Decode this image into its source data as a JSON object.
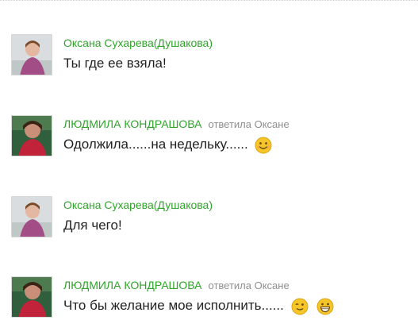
{
  "messages": [
    {
      "author": "Оксана Сухарева(Душакова)",
      "reply_note": "",
      "text": "Ты где ее взяла!",
      "emoticons": []
    },
    {
      "author": "ЛЮДМИЛА КОНДРАШОВА",
      "reply_note": "ответила Оксане",
      "text": "Одолжила......на недельку......",
      "emoticons": [
        "smile-icon"
      ]
    },
    {
      "author": "Оксана Сухарева(Душакова)",
      "reply_note": "",
      "text": "Для чего!",
      "emoticons": []
    },
    {
      "author": "ЛЮДМИЛА КОНДРАШОВА",
      "reply_note": "ответила Оксане",
      "text": "Что бы желание мое исполнить......",
      "emoticons": [
        "wink-icon",
        "grin-icon"
      ]
    }
  ],
  "colors": {
    "author_name": "#2fa52a",
    "reply_note": "#8f8f8f",
    "message_text": "#222222",
    "emoticon": "#f5c52a"
  }
}
